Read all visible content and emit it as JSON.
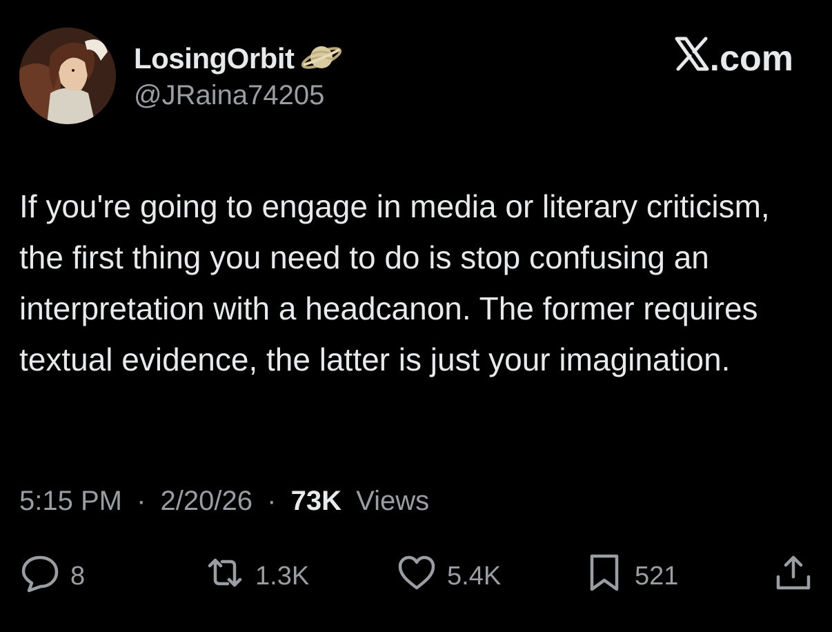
{
  "author": {
    "display_name": "LosingOrbit",
    "handle": "@JRaina74205",
    "badge_icon": "saturn-planet-icon"
  },
  "brand": {
    "label": ".com",
    "logo_icon": "x-logo-icon"
  },
  "tweet": {
    "text": "If you're going to engage in media or literary criticism, the first thing you need to do is stop confusing an interpretation with a headcanon. The former requires textual evidence, the latter is just your imagination.",
    "time": "5:15 PM",
    "date": "2/20/26",
    "separator": "·",
    "views_count": "73K",
    "views_label": "Views"
  },
  "actions": {
    "replies": "8",
    "reposts": "1.3K",
    "likes": "5.4K",
    "bookmarks": "521"
  },
  "colors": {
    "background": "#000000",
    "text_primary": "#e7e9ea",
    "text_secondary": "#9a9ea3"
  }
}
